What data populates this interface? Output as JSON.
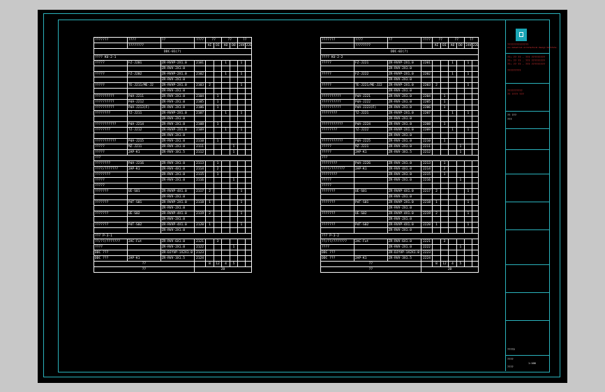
{
  "drawing": {
    "sheet_bg": "#000000",
    "frame_color": "#2bb5bf",
    "line_color": "#ffffff",
    "accent_red": "#ff3b3b"
  },
  "left_table": {
    "header": [
      "???????",
      "????",
      "??",
      "????",
      "??",
      "??",
      "??"
    ],
    "header2": [
      "",
      "????????",
      "",
      "",
      "AI",
      "DI",
      "AO",
      "DO",
      "24V",
      "220V"
    ],
    "ddc": "DDC-01(?)",
    "section1": "???? KU-2-1",
    "rows": [
      [
        "?????",
        "FZ-J201",
        "ZR-RVVP-2X1.0",
        "2101",
        "",
        "",
        "1",
        "",
        "1"
      ],
      [
        "",
        "",
        "ZR-RVV-2X1.0",
        "",
        "",
        "",
        "",
        "",
        ""
      ],
      [
        "?????",
        "FZ-J202",
        "ZR-RVVP-2X1.0",
        "2102",
        "",
        "",
        "1",
        "",
        "1"
      ],
      [
        "",
        "",
        "ZR-RVV-2X1.0",
        "",
        "",
        "",
        "",
        "",
        ""
      ],
      [
        "?????",
        "TE-J211/ME-J2",
        "ZR-RVVP-2X1.0",
        "2103",
        "2",
        "",
        "",
        "",
        "1"
      ],
      [
        "",
        "",
        "ZR-RVV-2X1.0",
        "",
        "",
        "",
        "",
        "",
        ""
      ],
      [
        "??????????",
        "PdA-J211",
        "ZR-RVV-2X1.0",
        "2104",
        "",
        "1",
        "",
        "",
        ""
      ],
      [
        "??????????",
        "PdA-J212",
        "ZR-RVV-2X1.0",
        "2105",
        "",
        "1",
        "",
        "",
        ""
      ],
      [
        "??????????",
        "PdA-J213(F)",
        "ZR-RVV-2X1.0",
        "2106",
        "",
        "1",
        "",
        "",
        ""
      ],
      [
        "????????",
        "TZ-J211",
        "ZR-RVVP-2X1.0",
        "2107",
        "",
        "",
        "1",
        "",
        "1"
      ],
      [
        "",
        "",
        "ZR-RVV-2X1.0",
        "",
        "",
        "",
        "",
        "",
        ""
      ],
      [
        "???????????",
        "PdA-J214",
        "ZR-RVV-2X1.0",
        "2108",
        "",
        "1",
        "",
        "",
        ""
      ],
      [
        "????????",
        "TZ-J212",
        "ZR-RVVP-2X1.0",
        "2109",
        "",
        "",
        "1",
        "",
        "1"
      ],
      [
        "",
        "",
        "ZR-RVV-2X1.0",
        "",
        "",
        "",
        "",
        "",
        ""
      ],
      [
        "???????????",
        "PdA-J215",
        "ZR-RVV-2X1.0",
        "2110",
        "",
        "1",
        "",
        "",
        ""
      ],
      [
        "?????",
        "MZ-J211",
        "ZR-RVV-2X1.0",
        "2111",
        "",
        "",
        "",
        "1",
        ""
      ],
      [
        "?????",
        "2AP-K1",
        "ZR-RVV-3X1.5",
        "2112",
        "",
        "",
        "",
        "1",
        ""
      ]
    ],
    "section2": "???",
    "rows2": [
      [
        "????????",
        "PdA-J216",
        "ZR-RVV-2X1.0",
        "2113",
        "",
        "1",
        "",
        "",
        ""
      ],
      [
        "????/???????",
        "2AP-K1",
        "ZR-RVV-4X1.0",
        "2114",
        "",
        "2",
        "",
        "",
        ""
      ],
      [
        "????????",
        "",
        "ZR-RVV-2X1.0",
        "2115",
        "",
        "1",
        "",
        "",
        ""
      ],
      [
        "?????",
        "",
        "ZR-RVV-2X1.0",
        "2116",
        "",
        "",
        "",
        "1",
        ""
      ],
      [
        "?????",
        "",
        "",
        "",
        "",
        "",
        "",
        "",
        ""
      ]
    ],
    "rows3": [
      [
        "???????",
        "UE-S01",
        "ZR-RVVP-4X1.0",
        "2117",
        "2",
        "",
        "",
        "",
        "1"
      ],
      [
        "",
        "",
        "ZR-RVV-2X1.0",
        "",
        "",
        "",
        "",
        "",
        ""
      ],
      [
        "???????",
        "PdT-S01",
        "ZR-RVVP-2X1.0",
        "2118",
        "1",
        "",
        "",
        "",
        "1"
      ],
      [
        "",
        "",
        "ZR-RVV-2X1.0",
        "",
        "",
        "",
        "",
        "",
        ""
      ],
      [
        "???????",
        "UE-S02",
        "ZR-RVVP-4X1.0",
        "2119",
        "2",
        "",
        "",
        "",
        "1"
      ],
      [
        "",
        "",
        "ZR-RVV-2X1.0",
        "",
        "",
        "",
        "",
        "",
        ""
      ],
      [
        "???????",
        "PdT-S02",
        "ZR-RVVP-4X1.0",
        "2120",
        "1",
        "",
        "",
        "",
        "1"
      ],
      [
        "",
        "",
        "ZR-RVV-2X1.0",
        "",
        "",
        "",
        "",
        "",
        ""
      ]
    ],
    "section3": "??? P-3-1",
    "rows4": [
      [
        "??/??/???????",
        "2AC-Fut",
        "ZR-RVV-6X1.0",
        "2121",
        "",
        "3",
        "",
        "",
        ""
      ],
      [
        "????",
        "",
        "ZR-RVV-2X1.0",
        "2122",
        "",
        "",
        "",
        "1",
        ""
      ],
      [
        "DDC ???",
        "",
        "ZR-DJYVP-1X2X1.0",
        "2123",
        "",
        "",
        "",
        "",
        ""
      ],
      [
        "DDC ???",
        "2AP-K1",
        "ZR-RVV-3X1.5",
        "2124",
        "",
        "",
        "",
        "",
        ""
      ]
    ],
    "sum_label": "??",
    "sums": [
      "8",
      "12",
      "4",
      "5"
    ],
    "total_label": "??",
    "total": "28"
  },
  "right_table": {
    "ddc": "DDC-02(?)",
    "section1": "???? KU-2-2",
    "rows": [
      [
        "?????",
        "FZ-J221",
        "ZR-RVVP-2X1.0",
        "2201",
        "",
        "",
        "1",
        "",
        "1"
      ],
      [
        "",
        "",
        "ZR-RVV-2X1.0",
        "",
        "",
        "",
        "",
        "",
        ""
      ],
      [
        "?????",
        "FZ-J222",
        "ZR-RVVP-2X1.0",
        "2202",
        "",
        "",
        "1",
        "",
        "1"
      ],
      [
        "",
        "",
        "ZR-RVV-2X1.0",
        "",
        "",
        "",
        "",
        "",
        ""
      ],
      [
        "?????",
        "TE-J221/ME-J22",
        "ZR-RVVP-2X1.0",
        "2203",
        "2",
        "",
        "",
        "",
        "1"
      ],
      [
        "",
        "",
        "ZR-RVV-2X1.0",
        "",
        "",
        "",
        "",
        "",
        ""
      ],
      [
        "??????????",
        "PdA-J221",
        "ZR-RVV-2X1.0",
        "2204",
        "",
        "1",
        "",
        "",
        ""
      ],
      [
        "??????????",
        "PdA-J222",
        "ZR-RVV-2X1.0",
        "2205",
        "",
        "1",
        "",
        "",
        ""
      ],
      [
        "??????????",
        "PdA-J223(F)",
        "ZR-RVV-2X1.0",
        "2206",
        "",
        "1",
        "",
        "",
        ""
      ],
      [
        "????????",
        "TZ-J221",
        "ZR-RVVP-2X1.0",
        "2207",
        "",
        "",
        "1",
        "",
        "1"
      ],
      [
        "",
        "",
        "ZR-RVV-2X1.0",
        "",
        "",
        "",
        "",
        "",
        ""
      ],
      [
        "???????????",
        "PdA-J224",
        "ZR-RVV-2X1.0",
        "2208",
        "",
        "1",
        "",
        "",
        ""
      ],
      [
        "????????",
        "TZ-J222",
        "ZR-RVVP-2X1.0",
        "2209",
        "",
        "",
        "1",
        "",
        "1"
      ],
      [
        "",
        "",
        "ZR-RVV-2X1.0",
        "",
        "",
        "",
        "",
        "",
        ""
      ],
      [
        "???????????",
        "PdA-J225",
        "ZR-RVV-2X1.0",
        "2210",
        "",
        "1",
        "",
        "",
        ""
      ],
      [
        "?????",
        "MZ-J221",
        "ZR-RVV-2X1.0",
        "2211",
        "",
        "",
        "",
        "1",
        ""
      ],
      [
        "?????",
        "2AP-K1",
        "ZR-RVV-3X1.5",
        "2212",
        "",
        "",
        "",
        "1",
        ""
      ]
    ],
    "section2": "???",
    "rows2": [
      [
        "????????",
        "PdA-J226",
        "ZR-RVV-2X1.0",
        "2213",
        "",
        "1",
        "",
        "",
        ""
      ],
      [
        "????/???????",
        "2AP-K1",
        "ZR-RVV-4X1.0",
        "2214",
        "",
        "2",
        "",
        "",
        ""
      ],
      [
        "????????",
        "",
        "ZR-RVV-2X1.0",
        "2215",
        "",
        "1",
        "",
        "",
        ""
      ],
      [
        "?????",
        "",
        "ZR-RVV-2X1.0",
        "2216",
        "",
        "",
        "",
        "1",
        ""
      ],
      [
        "?????",
        "",
        "",
        "",
        "",
        "",
        "",
        "",
        ""
      ]
    ],
    "rows3": [
      [
        "???????",
        "UE-S01",
        "ZR-RVVP-4X1.0",
        "2217",
        "2",
        "",
        "",
        "",
        "1"
      ],
      [
        "",
        "",
        "ZR-RVV-2X1.0",
        "",
        "",
        "",
        "",
        "",
        ""
      ],
      [
        "???????",
        "PdT-S01",
        "ZR-RVVP-2X1.0",
        "2218",
        "1",
        "",
        "",
        "",
        "1"
      ],
      [
        "",
        "",
        "ZR-RVV-2X1.0",
        "",
        "",
        "",
        "",
        "",
        ""
      ],
      [
        "???????",
        "UE-S02",
        "ZR-RVVP-4X1.0",
        "2219",
        "2",
        "",
        "",
        "",
        "1"
      ],
      [
        "",
        "",
        "ZR-RVV-2X1.0",
        "",
        "",
        "",
        "",
        "",
        ""
      ],
      [
        "???????",
        "PdT-S02",
        "ZR-RVVP-4X1.0",
        "2220",
        "1",
        "",
        "",
        "",
        "1"
      ],
      [
        "",
        "",
        "ZR-RVV-2X1.0",
        "",
        "",
        "",
        "",
        "",
        ""
      ]
    ],
    "section3": "??? P-3-2",
    "rows4": [
      [
        "??/??/???????",
        "2AC-Fut",
        "ZR-RVV-6X1.0",
        "2221",
        "",
        "3",
        "",
        "",
        ""
      ],
      [
        "????",
        "",
        "ZR-RVV-2X1.0",
        "2222",
        "",
        "",
        "",
        "1",
        ""
      ],
      [
        "DDC ???",
        "",
        "ZR-DJYVP-1X2X1.0",
        "2223",
        "",
        "",
        "",
        "",
        ""
      ],
      [
        "DDC ???",
        "2AP-K1",
        "ZR-RVV-3X1.5",
        "2224",
        "",
        "",
        "",
        "",
        ""
      ]
    ],
    "sum_label": "??",
    "sums": [
      "8",
      "12",
      "4",
      "5"
    ],
    "total_label": "??",
    "total": "28"
  },
  "title_block": {
    "company": "??????????????",
    "company_en": "xxx Industrial Architectural Design Institute",
    "cert": "??: ?? ?? - ??? ?????????",
    "section_label": "?????????",
    "project_label": "??????????",
    "date_label": "?? ???? ???",
    "sheet_no": "?? ???",
    "stage": "???",
    "drawing_title": "????2",
    "scale": "????",
    "sheet_of": "1:100",
    "page": "????"
  }
}
